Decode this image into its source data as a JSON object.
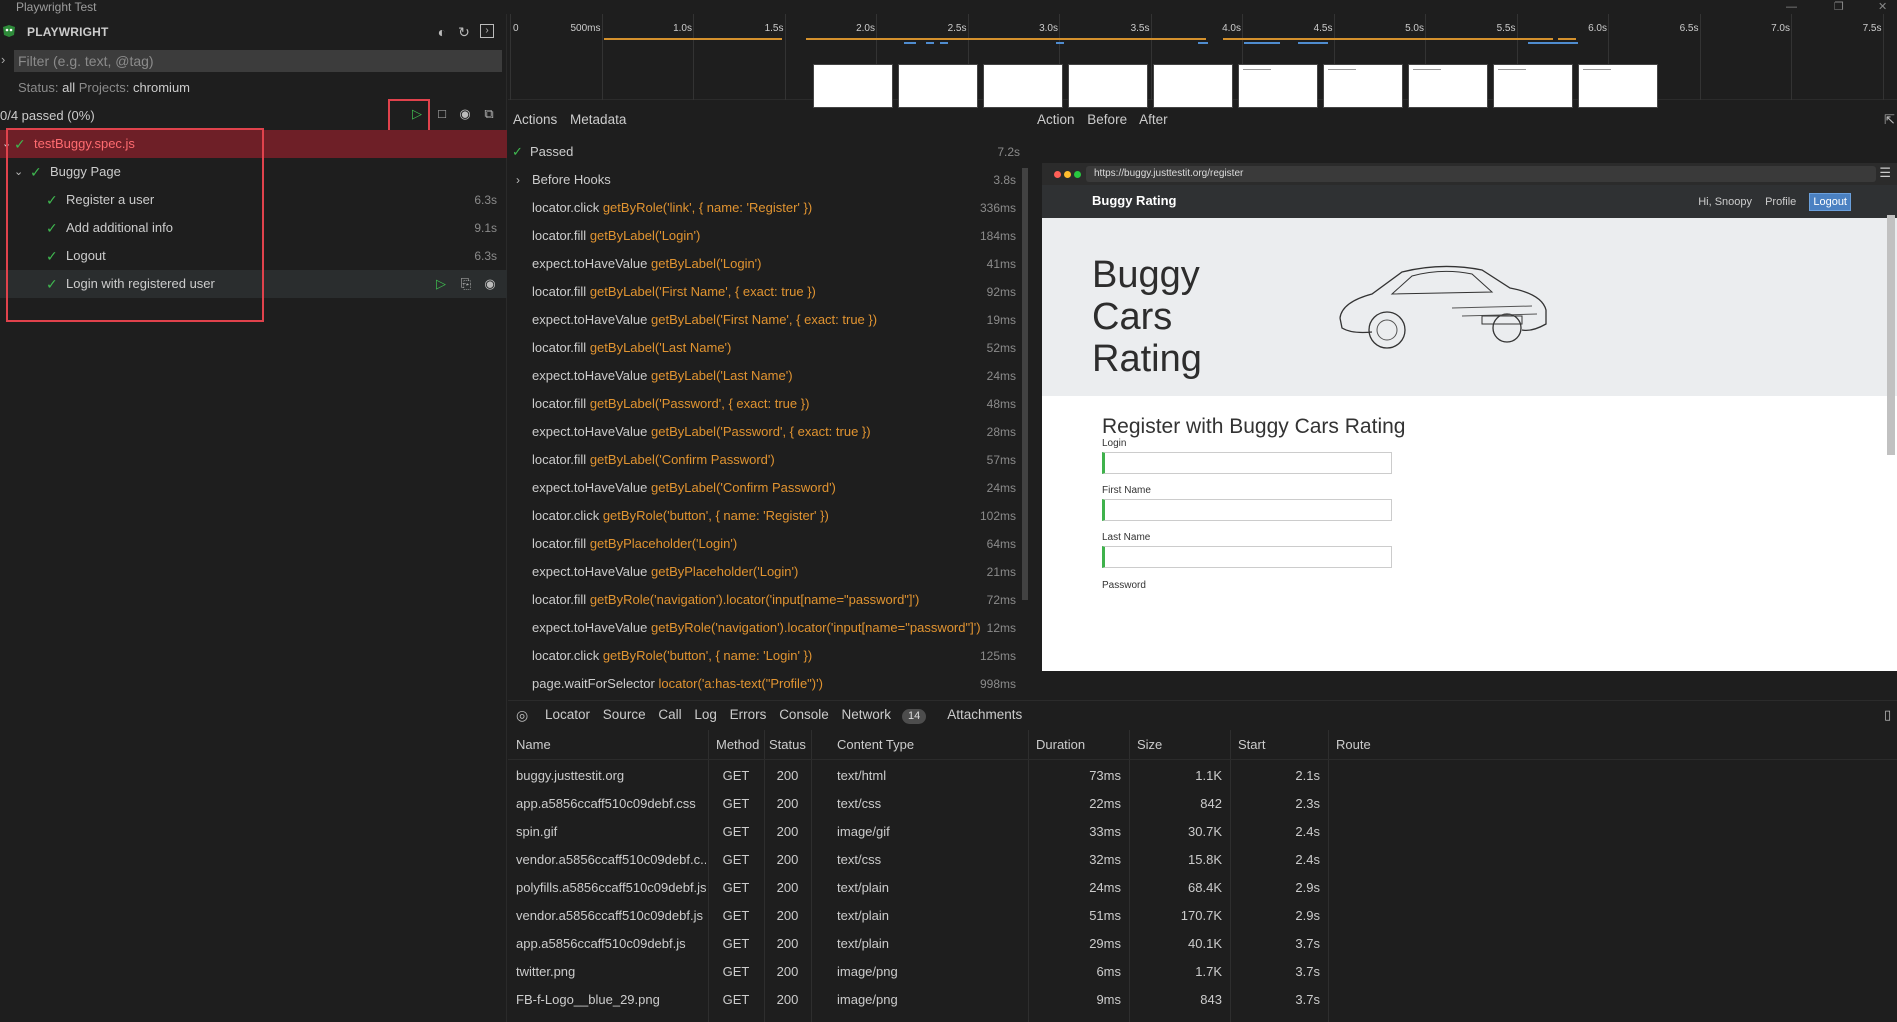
{
  "window": {
    "title": "Playwright Test"
  },
  "sidebar": {
    "header": "PLAYWRIGHT",
    "filter_placeholder": "Filter (e.g. text, @tag)",
    "status_label": "Status:",
    "status_value": "all",
    "projects_label": "Projects:",
    "projects_value": "chromium",
    "passed_summary": "0/4 passed (0%)",
    "tree": [
      {
        "label": "testBuggy.spec.js",
        "duration": ""
      },
      {
        "label": "Buggy Page",
        "duration": ""
      },
      {
        "label": "Register a user",
        "duration": "6.3s"
      },
      {
        "label": "Add additional info",
        "duration": "9.1s"
      },
      {
        "label": "Logout",
        "duration": "6.3s"
      },
      {
        "label": "Login with registered user",
        "duration": ""
      }
    ]
  },
  "timeline": {
    "ticks": [
      "0",
      "500ms",
      "1.0s",
      "1.5s",
      "2.0s",
      "2.5s",
      "3.0s",
      "3.5s",
      "4.0s",
      "4.5s",
      "5.0s",
      "5.5s",
      "6.0s",
      "6.5s",
      "7.0s",
      "7.5s"
    ]
  },
  "actions_pane": {
    "tabs": [
      "Actions",
      "Metadata"
    ],
    "status": "Passed",
    "status_duration": "7.2s",
    "items": [
      {
        "method": "Before Hooks",
        "selector": "",
        "duration": "3.8s"
      },
      {
        "method": "locator.click",
        "selector": "getByRole('link', { name: 'Register' })",
        "duration": "336ms"
      },
      {
        "method": "locator.fill",
        "selector": "getByLabel('Login')",
        "duration": "184ms"
      },
      {
        "method": "expect.toHaveValue",
        "selector": "getByLabel('Login')",
        "duration": "41ms"
      },
      {
        "method": "locator.fill",
        "selector": "getByLabel('First Name', { exact: true })",
        "duration": "92ms"
      },
      {
        "method": "expect.toHaveValue",
        "selector": "getByLabel('First Name', { exact: true })",
        "duration": "19ms"
      },
      {
        "method": "locator.fill",
        "selector": "getByLabel('Last Name')",
        "duration": "52ms"
      },
      {
        "method": "expect.toHaveValue",
        "selector": "getByLabel('Last Name')",
        "duration": "24ms"
      },
      {
        "method": "locator.fill",
        "selector": "getByLabel('Password', { exact: true })",
        "duration": "48ms"
      },
      {
        "method": "expect.toHaveValue",
        "selector": "getByLabel('Password', { exact: true })",
        "duration": "28ms"
      },
      {
        "method": "locator.fill",
        "selector": "getByLabel('Confirm Password')",
        "duration": "57ms"
      },
      {
        "method": "expect.toHaveValue",
        "selector": "getByLabel('Confirm Password')",
        "duration": "24ms"
      },
      {
        "method": "locator.click",
        "selector": "getByRole('button', { name: 'Register' })",
        "duration": "102ms"
      },
      {
        "method": "locator.fill",
        "selector": "getByPlaceholder('Login')",
        "duration": "64ms"
      },
      {
        "method": "expect.toHaveValue",
        "selector": "getByPlaceholder('Login')",
        "duration": "21ms"
      },
      {
        "method": "locator.fill",
        "selector": "getByRole('navigation').locator('input[name=\"password\"]')",
        "duration": "72ms"
      },
      {
        "method": "expect.toHaveValue",
        "selector": "getByRole('navigation').locator('input[name=\"password\"]')",
        "duration": "12ms"
      },
      {
        "method": "locator.click",
        "selector": "getByRole('button', { name: 'Login' })",
        "duration": "125ms"
      },
      {
        "method": "page.waitForSelector",
        "selector": "locator('a:has-text(\"Profile\")')",
        "duration": "998ms"
      }
    ]
  },
  "snapshot_pane": {
    "tabs": [
      "Action",
      "Before",
      "After"
    ],
    "url": "https://buggy.justtestit.org/register",
    "brand": "Buggy Rating",
    "nav": {
      "greeting": "Hi, Snoopy",
      "profile": "Profile",
      "logout": "Logout"
    },
    "hero_lines": [
      "Buggy",
      "Cars",
      "Rating"
    ],
    "form_title": "Register with Buggy Cars Rating",
    "fields": [
      "Login",
      "First Name",
      "Last Name",
      "Password"
    ]
  },
  "detail_tabs": {
    "items": [
      "Locator",
      "Source",
      "Call",
      "Log",
      "Errors",
      "Console",
      "Network",
      "Attachments"
    ],
    "network_count": "14"
  },
  "network": {
    "columns": [
      "Name",
      "Method",
      "Status",
      "Content Type",
      "Duration",
      "Size",
      "Start",
      "Route"
    ],
    "rows": [
      [
        "buggy.justtestit.org",
        "GET",
        "200",
        "text/html",
        "73ms",
        "1.1K",
        "2.1s"
      ],
      [
        "app.a5856ccaff510c09debf.css",
        "GET",
        "200",
        "text/css",
        "22ms",
        "842",
        "2.3s"
      ],
      [
        "spin.gif",
        "GET",
        "200",
        "image/gif",
        "33ms",
        "30.7K",
        "2.4s"
      ],
      [
        "vendor.a5856ccaff510c09debf.c...",
        "GET",
        "200",
        "text/css",
        "32ms",
        "15.8K",
        "2.4s"
      ],
      [
        "polyfills.a5856ccaff510c09debf.js",
        "GET",
        "200",
        "text/plain",
        "24ms",
        "68.4K",
        "2.9s"
      ],
      [
        "vendor.a5856ccaff510c09debf.js",
        "GET",
        "200",
        "text/plain",
        "51ms",
        "170.7K",
        "2.9s"
      ],
      [
        "app.a5856ccaff510c09debf.js",
        "GET",
        "200",
        "text/plain",
        "29ms",
        "40.1K",
        "3.7s"
      ],
      [
        "twitter.png",
        "GET",
        "200",
        "image/png",
        "6ms",
        "1.7K",
        "3.7s"
      ],
      [
        "FB-f-Logo__blue_29.png",
        "GET",
        "200",
        "image/png",
        "9ms",
        "843",
        "3.7s"
      ]
    ]
  },
  "colors": {
    "accent": "#3fb950",
    "selector": "#e19431",
    "selected_row": "#6e1f27",
    "highlight_box": "#e0424c"
  }
}
